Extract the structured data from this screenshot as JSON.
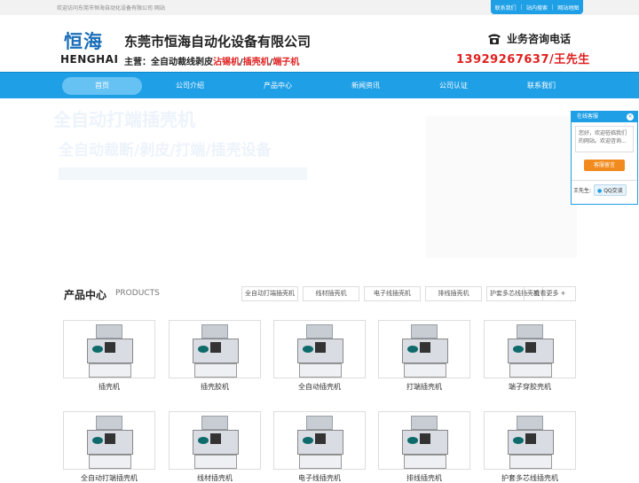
{
  "topbar": {
    "welcome": "欢迎访问东莞市恒海自动化设备有限公司 网站",
    "links": [
      "联系我们",
      "站内搜索",
      "网站地图"
    ]
  },
  "header": {
    "logo_cn": "恒海",
    "logo_en": "HENGHAI",
    "company": "东莞市恒海自动化设备有限公司",
    "slogan_prefix": "主营：全自动裁线剥皮",
    "slogan_items": [
      "沾锡机",
      "插壳机",
      "端子机"
    ],
    "slogan_sep": "/",
    "phone_label": "业务咨询电话",
    "phone_number": "13929267637/王先生"
  },
  "nav": [
    "首页",
    "公司介绍",
    "产品中心",
    "新闻资讯",
    "公司认证",
    "联系我们"
  ],
  "banner": {
    "line1": "全自动打端插壳机",
    "line2": "全自动裁断/剥皮/打端/插壳设备"
  },
  "kefu": {
    "title": "在线客服",
    "message": "您好，欢迎莅临我们的网站。欢迎咨询...",
    "button": "客服留言",
    "contact_name": "王先生:",
    "qq_label": "QQ交谈"
  },
  "products": {
    "title": "产品中心",
    "title_en": "PRODUCTS",
    "tabs": [
      "全自动打端插壳机",
      "线材插壳机",
      "电子线插壳机",
      "排线插壳机",
      "护套多芯线插壳机"
    ],
    "more": "查看更多 +",
    "items": [
      "插壳机",
      "插壳胶机",
      "全自动插壳机",
      "打端插壳机",
      "端子穿胶壳机",
      "全自动打端插壳机",
      "线材插壳机",
      "电子线插壳机",
      "排线插壳机",
      "护套多芯线插壳机"
    ]
  },
  "colors": {
    "primary": "#1e9fe6",
    "accent": "#e02020"
  }
}
